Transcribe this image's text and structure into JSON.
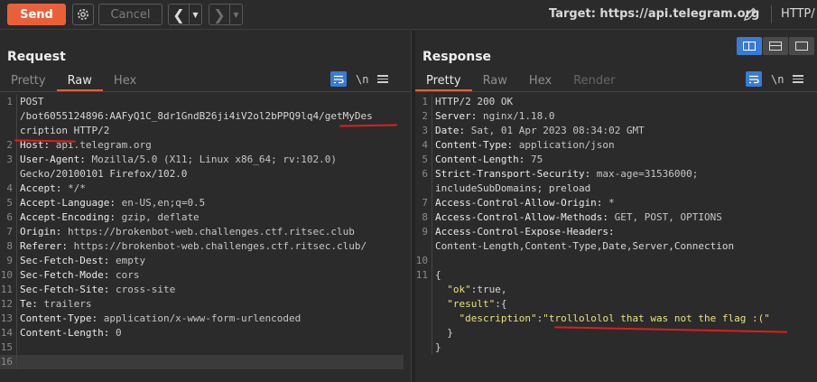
{
  "toolbar": {
    "send_label": "Send",
    "cancel_label": "Cancel",
    "settings_icon": "gear-icon",
    "back_icon": "chevron-left-icon",
    "forward_icon": "chevron-right-icon",
    "target_label": "Target: https://api.telegram.org",
    "protocol_label": "HTTP/"
  },
  "request": {
    "title": "Request",
    "tabs": [
      "Pretty",
      "Raw",
      "Hex"
    ],
    "active_tab": "Raw",
    "newline_toggle": "\\n",
    "lines": [
      {
        "n": "1",
        "text": "POST"
      },
      {
        "n": "",
        "text": "/bot6055124896:AAFyQ1C_8dr1GndB26ji4iV2ol2bPPQ9lq4/getMyDes"
      },
      {
        "n": "",
        "text": "cription HTTP/2"
      },
      {
        "n": "2",
        "key": "Host",
        "value": "api.telegram.org"
      },
      {
        "n": "3",
        "key": "User-Agent",
        "value": "Mozilla/5.0 (X11; Linux x86_64; rv:102.0)"
      },
      {
        "n": "",
        "text": "Gecko/20100101 Firefox/102.0"
      },
      {
        "n": "4",
        "key": "Accept",
        "value": "*/*"
      },
      {
        "n": "5",
        "key": "Accept-Language",
        "value": "en-US,en;q=0.5"
      },
      {
        "n": "6",
        "key": "Accept-Encoding",
        "value": "gzip, deflate"
      },
      {
        "n": "7",
        "key": "Origin",
        "value": "https://brokenbot-web.challenges.ctf.ritsec.club"
      },
      {
        "n": "8",
        "key": "Referer",
        "value": "https://brokenbot-web.challenges.ctf.ritsec.club/"
      },
      {
        "n": "9",
        "key": "Sec-Fetch-Dest",
        "value": "empty"
      },
      {
        "n": "10",
        "key": "Sec-Fetch-Mode",
        "value": "cors"
      },
      {
        "n": "11",
        "key": "Sec-Fetch-Site",
        "value": "cross-site"
      },
      {
        "n": "12",
        "key": "Te",
        "value": "trailers"
      },
      {
        "n": "13",
        "key": "Content-Type",
        "value": "application/x-www-form-urlencoded"
      },
      {
        "n": "14",
        "key": "Content-Length",
        "value": "0"
      },
      {
        "n": "15",
        "text": ""
      },
      {
        "n": "16",
        "text": "",
        "current": true
      }
    ]
  },
  "response": {
    "title": "Response",
    "tabs": [
      "Pretty",
      "Raw",
      "Hex",
      "Render"
    ],
    "active_tab": "Pretty",
    "newline_toggle": "\\n",
    "lines": [
      {
        "n": "1",
        "text": "HTTP/2 200 OK"
      },
      {
        "n": "2",
        "key": "Server",
        "value": "nginx/1.18.0"
      },
      {
        "n": "3",
        "key": "Date",
        "value": "Sat, 01 Apr 2023 08:34:02 GMT"
      },
      {
        "n": "4",
        "key": "Content-Type",
        "value": "application/json"
      },
      {
        "n": "5",
        "key": "Content-Length",
        "value": "75"
      },
      {
        "n": "6",
        "key": "Strict-Transport-Security",
        "value": "max-age=31536000;"
      },
      {
        "n": "",
        "text": "includeSubDomains; preload"
      },
      {
        "n": "7",
        "key": "Access-Control-Allow-Origin",
        "value": "*"
      },
      {
        "n": "8",
        "key": "Access-Control-Allow-Methods",
        "value": "GET, POST, OPTIONS"
      },
      {
        "n": "9",
        "key": "Access-Control-Expose-Headers",
        "value": ""
      },
      {
        "n": "",
        "text": "Content-Length,Content-Type,Date,Server,Connection"
      },
      {
        "n": "10",
        "text": ""
      },
      {
        "n": "11",
        "text": "{"
      },
      {
        "n": "",
        "indent": "  ",
        "jkey": "\"ok\"",
        "jval": "true,"
      },
      {
        "n": "",
        "indent": "  ",
        "jkey": "\"result\"",
        "jval": "{"
      },
      {
        "n": "",
        "indent": "    ",
        "jkey": "\"description\"",
        "jstr": "\"trollololol that was not the flag :(\""
      },
      {
        "n": "",
        "text": "  }"
      },
      {
        "n": "",
        "text": "}"
      }
    ]
  },
  "colors": {
    "accent": "#e8603a",
    "toggle_active": "#3a7bd5",
    "annotation": "#e31c1c"
  }
}
